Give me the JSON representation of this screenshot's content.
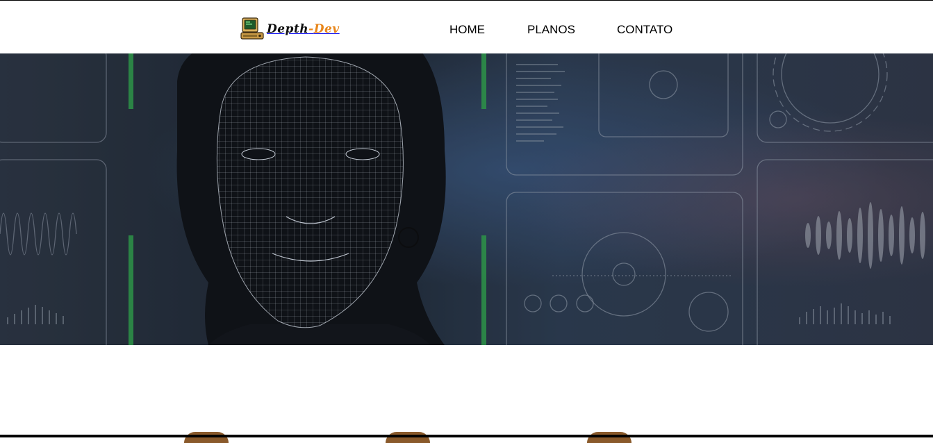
{
  "brand": {
    "name_part1": "Depth",
    "name_sep": "-",
    "name_part2": "Dev",
    "icon": "retro-computer-icon",
    "accent_color": "#e8861a"
  },
  "nav": {
    "items": [
      {
        "label": "HOME"
      },
      {
        "label": "PLANOS"
      },
      {
        "label": "CONTATO"
      }
    ]
  },
  "hero": {
    "image": "face-recognition-mesh-banner",
    "overlay_color": "#1f2a3a",
    "accent_bar_color": "#2fa24a"
  }
}
